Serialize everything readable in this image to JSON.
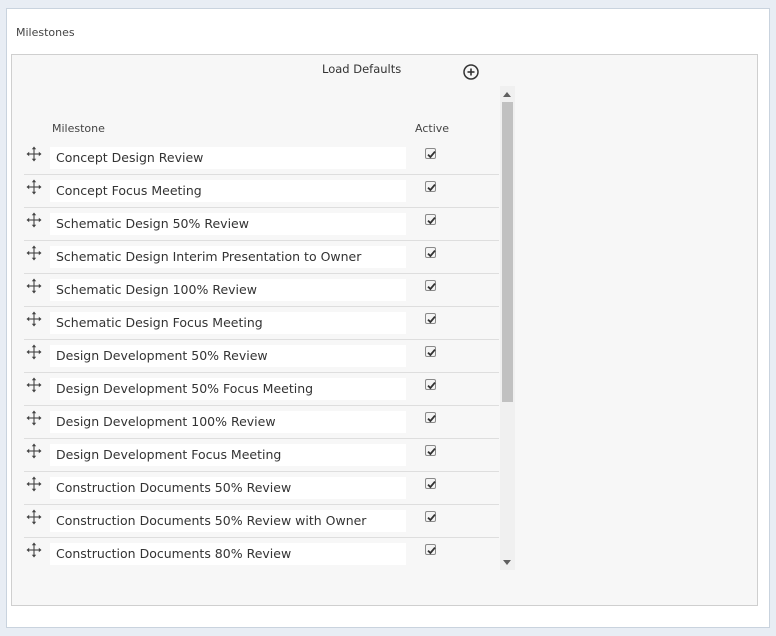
{
  "section": {
    "title": "Milestones"
  },
  "toolbar": {
    "load_defaults_label": "Load Defaults",
    "add_icon": "plus-circle-icon"
  },
  "table": {
    "columns": {
      "milestone": "Milestone",
      "active": "Active"
    },
    "rows": [
      {
        "name": "Concept Design Review",
        "active": true
      },
      {
        "name": "Concept Focus Meeting",
        "active": true
      },
      {
        "name": "Schematic Design 50% Review",
        "active": true
      },
      {
        "name": "Schematic Design Interim Presentation to Owner",
        "active": true
      },
      {
        "name": "Schematic Design 100% Review",
        "active": true
      },
      {
        "name": "Schematic Design Focus Meeting",
        "active": true
      },
      {
        "name": "Design Development 50% Review",
        "active": true
      },
      {
        "name": "Design Development 50% Focus Meeting",
        "active": true
      },
      {
        "name": "Design Development 100% Review",
        "active": true
      },
      {
        "name": "Design Development Focus Meeting",
        "active": true
      },
      {
        "name": "Construction Documents 50% Review",
        "active": true
      },
      {
        "name": "Construction Documents 50% Review with Owner",
        "active": true
      },
      {
        "name": "Construction Documents 80% Review",
        "active": true
      }
    ]
  },
  "scroll": {
    "visible_fraction": 0.66,
    "position_fraction": 0.0
  },
  "colors": {
    "page_bg": "#e8edf4",
    "panel_bg": "#f7f7f7",
    "check": "#333333"
  }
}
